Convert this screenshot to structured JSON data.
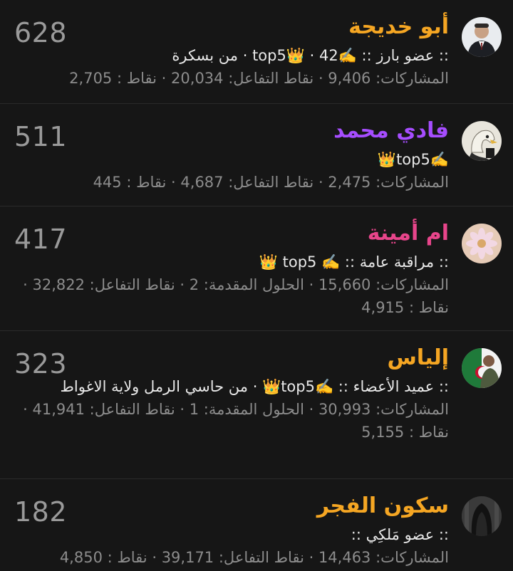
{
  "members": [
    {
      "name": "أبو خديجة",
      "name_color": "#f5a623",
      "score": "628",
      "rank_line": ":: عضو بارز :: ✍️top5👑 · 42 · من بسكرة",
      "stats_line": "المشاركات: 9,406 · نقاط التفاعل: 20,034 · نقاط : 2,705",
      "avatar": "man-in-suit-avatar"
    },
    {
      "name": "فادي محمد",
      "name_color": "#a64dff",
      "score": "511",
      "rank_line": "✍️top5👑",
      "stats_line": "المشاركات: 2,475 · نقاط التفاعل: 4,687 · نقاط : 445",
      "avatar": "eagle-avatar"
    },
    {
      "name": "ام أمينة",
      "name_color": "#e8458b",
      "score": "417",
      "rank_line": ":: مراقبة عامة :: ✍️ top5 👑",
      "stats_line": "المشاركات: 15,660 · الحلول المقدمة: 2 · نقاط التفاعل: 32,822 · نقاط : 4,915",
      "avatar": "flower-avatar"
    },
    {
      "name": "إلياس",
      "name_color": "#f5a623",
      "score": "323",
      "rank_line": ":: عميد الأعضاء :: ✍️top5👑 · من حاسي الرمل ولاية الاغواط",
      "stats_line": "المشاركات: 30,993 · الحلول المقدمة: 1 · نقاط التفاعل: 41,941 · نقاط : 5,155",
      "avatar": "flag-avatar"
    },
    {
      "name": "سكون الفجر",
      "name_color": "#f5a623",
      "score": "182",
      "rank_line": ":: عضو مَلكِي ::",
      "stats_line": "المشاركات: 14,463 · نقاط التفاعل: 39,171 · نقاط : 4,850",
      "avatar": "hooded-figure-avatar"
    }
  ]
}
